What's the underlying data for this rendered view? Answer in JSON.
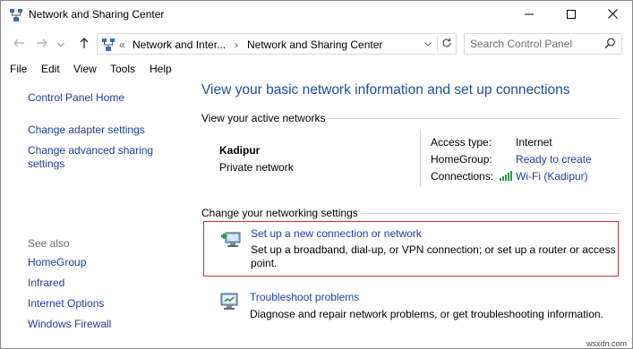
{
  "window": {
    "title": "Network and Sharing Center",
    "controls": {
      "minimize": "minimize-icon",
      "maximize": "maximize-icon",
      "close": "close-icon"
    }
  },
  "address": {
    "overflow": "«",
    "crumbs": [
      "Network and Inter...",
      "Network and Sharing Center"
    ],
    "separator": "›"
  },
  "search": {
    "placeholder": "Search Control Panel"
  },
  "menu": [
    "File",
    "Edit",
    "View",
    "Tools",
    "Help"
  ],
  "left": {
    "home": "Control Panel Home",
    "links": [
      "Change adapter settings",
      "Change advanced sharing settings"
    ],
    "see_also_label": "See also",
    "see_also": [
      "HomeGroup",
      "Infrared",
      "Internet Options",
      "Windows Firewall"
    ]
  },
  "main": {
    "title": "View your basic network information and set up connections",
    "active_label": "View your active networks",
    "network": {
      "name": "Kadipur",
      "type": "Private network",
      "access_type_label": "Access type:",
      "access_type": "Internet",
      "homegroup_label": "HomeGroup:",
      "homegroup": "Ready to create",
      "connections_label": "Connections:",
      "connection": "Wi-Fi (Kadipur)"
    },
    "change_label": "Change your networking settings",
    "tasks": [
      {
        "title": "Set up a new connection or network",
        "desc": "Set up a broadband, dial-up, or VPN connection; or set up a router or access point."
      },
      {
        "title": "Troubleshoot problems",
        "desc": "Diagnose and repair network problems, or get troubleshooting information."
      }
    ]
  },
  "watermark": "wsxdn.com",
  "colors": {
    "link": "#1c3f9c",
    "title": "#1e4e9c",
    "highlight": "#c8323a"
  }
}
